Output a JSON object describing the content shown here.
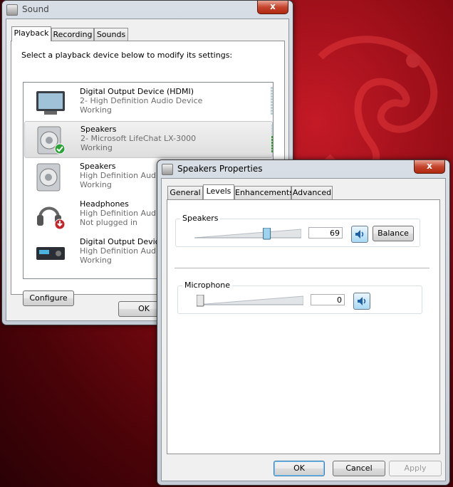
{
  "sound_window": {
    "title": "Sound",
    "close_label": "x",
    "tabs": [
      {
        "label": "Playback",
        "active": true
      },
      {
        "label": "Recording",
        "active": false
      },
      {
        "label": "Sounds",
        "active": false
      }
    ],
    "instruction": "Select a playback device below to modify its settings:",
    "devices": [
      {
        "name": "Digital Output Device (HDMI)",
        "sub": "2- High Definition Audio Device",
        "status": "Working",
        "icon": "monitor-icon",
        "meter_level": 0,
        "selected": false
      },
      {
        "name": "Speakers",
        "sub": "2- Microsoft LifeChat LX-3000",
        "status": "Working",
        "icon": "speaker-default-icon",
        "meter_level": 0.6,
        "selected": true
      },
      {
        "name": "Speakers",
        "sub": "High Definition Audio D",
        "status": "Working",
        "icon": "speaker-icon",
        "meter_level": 0,
        "selected": false
      },
      {
        "name": "Headphones",
        "sub": "High Definition Audio D",
        "status": "Not plugged in",
        "icon": "headphones-unplugged-icon",
        "meter_level": 0,
        "selected": false
      },
      {
        "name": "Digital Output Device (S",
        "sub": "High Definition Audio D",
        "status": "Working",
        "icon": "receiver-icon",
        "meter_level": 0,
        "selected": false
      }
    ],
    "configure_label": "Configure",
    "ok_label": "OK"
  },
  "props_window": {
    "title": "Speakers Properties",
    "close_label": "x",
    "tabs": [
      {
        "label": "General",
        "active": false
      },
      {
        "label": "Levels",
        "active": true
      },
      {
        "label": "Enhancements",
        "active": false
      },
      {
        "label": "Advanced",
        "active": false
      }
    ],
    "speakers": {
      "label": "Speakers",
      "value": "69",
      "level": 0.69,
      "balance_label": "Balance"
    },
    "microphone": {
      "label": "Microphone",
      "value": "0",
      "level": 0
    },
    "ok_label": "OK",
    "cancel_label": "Cancel",
    "apply_label": "Apply"
  }
}
